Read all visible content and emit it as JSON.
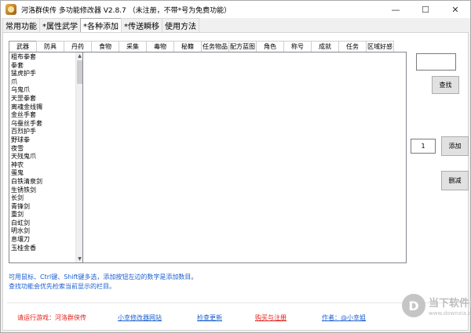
{
  "window": {
    "title": "河洛群侠传 多功能修改器 V2.8.7 （未注册，不带*号为免费功能）",
    "controls": {
      "minimize": "—",
      "maximize": "☐",
      "close": "✕"
    }
  },
  "top_tabs": [
    {
      "label": "常用功能",
      "active": false
    },
    {
      "label": "*属性武学",
      "active": false
    },
    {
      "label": "*各种添加",
      "active": true
    },
    {
      "label": "*传送瞬移",
      "active": false
    },
    {
      "label": "使用方法",
      "active": false
    }
  ],
  "sub_tabs": [
    {
      "label": "武器",
      "active": true
    },
    {
      "label": "防具"
    },
    {
      "label": "丹药"
    },
    {
      "label": "食物"
    },
    {
      "label": "采集"
    },
    {
      "label": "毒物"
    },
    {
      "label": "秘籍"
    },
    {
      "label": "任务物品"
    },
    {
      "label": "配方蓝图"
    },
    {
      "label": "角色"
    },
    {
      "label": "称号"
    },
    {
      "label": "成就"
    },
    {
      "label": "任务"
    },
    {
      "label": "区域好感"
    }
  ],
  "item_list": [
    "粗布拳套",
    "拳套",
    "猛虎护手",
    "爪",
    "乌鬼爪",
    "天罡拳套",
    "离魂金线镯",
    "金丝手套",
    "乌蚕丝手套",
    "百烈护手",
    "野球拳",
    "夜雪",
    "天残鬼爪",
    "神农",
    "蛋鬼",
    "白铁清泉剑",
    "生锈铁剑",
    "长剑",
    "青锋剑",
    "重剑",
    "白虹剑",
    "明水剑",
    "息壤刀",
    "玉桂金香"
  ],
  "right_panel": {
    "search_value": "",
    "search_button": "查找",
    "quantity_value": "1",
    "add_button": "添加",
    "delete_button": "删减"
  },
  "hints": {
    "line1": "可用鼠标、Ctrl键、Shift键多选，添加按钮左边的数字是添加数目。",
    "line2": "查找功能会优先检索当前显示的栏目。"
  },
  "footer": {
    "status": "请运行游戏：河洛群侠传",
    "site_link": "小幸修改器网站",
    "update_link": "检查更新",
    "buy_link": "购买与注册",
    "author": "作者：@小幸姐"
  },
  "watermark": {
    "logo": "D",
    "name": "当下软件园",
    "url": "www.downxia.com"
  }
}
